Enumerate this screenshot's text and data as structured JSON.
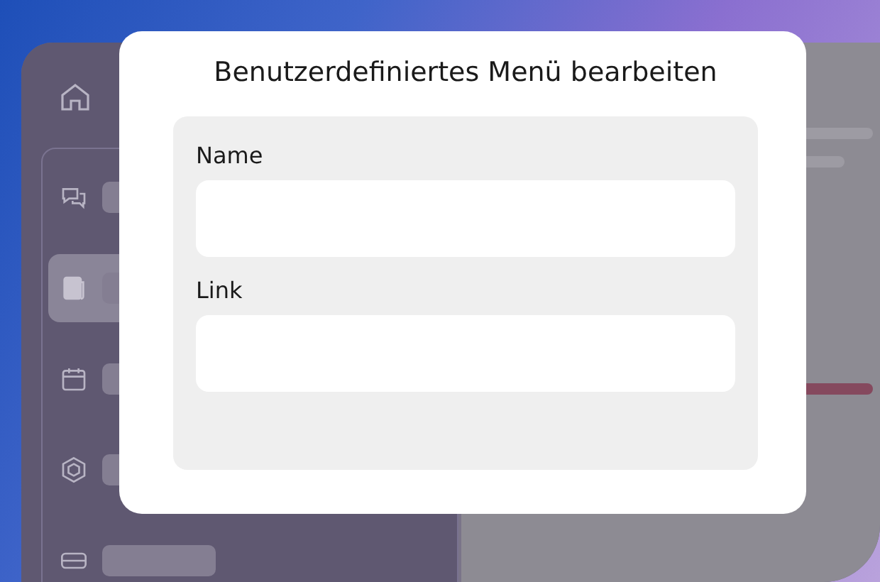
{
  "sidebar": {
    "items": [
      {
        "selected": false
      },
      {
        "selected": true
      },
      {
        "selected": false
      },
      {
        "selected": false
      },
      {
        "selected": false
      }
    ]
  },
  "dialog": {
    "title": "Benutzerdefiniertes Menü bearbeiten",
    "fields": [
      {
        "label": "Name"
      },
      {
        "label": "Link"
      }
    ]
  }
}
